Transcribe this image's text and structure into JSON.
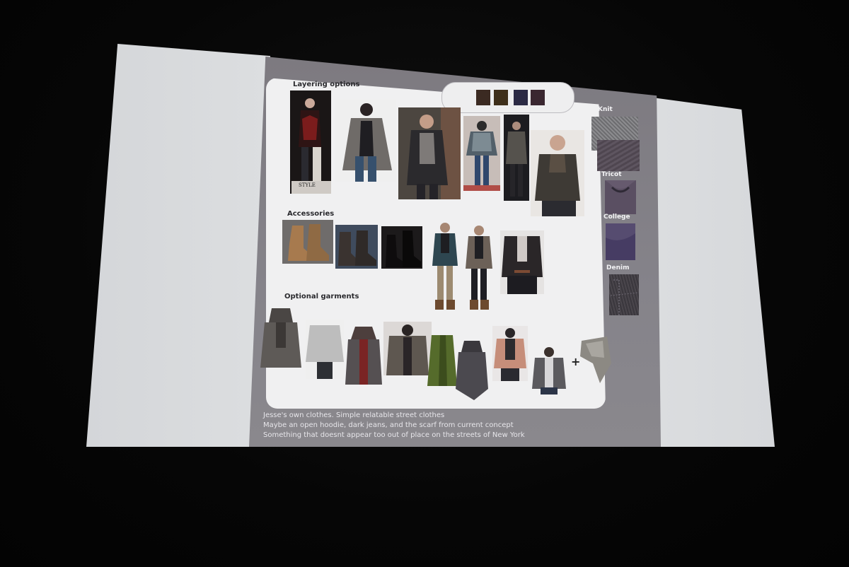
{
  "slide": {
    "sections": {
      "layering": "Layering options",
      "accessories": "Accessories",
      "optional": "Optional garments"
    },
    "fabrics": {
      "knit": "Knit",
      "tricot": "Tricot",
      "college": "College",
      "denim": "Denim"
    },
    "photo_text": {
      "style_tag": "STYLE"
    },
    "plus_sign": "+",
    "caption": {
      "line1": "Jesse's own clothes. Simple relatable street clothes",
      "line2": "Maybe an open hoodie, dark jeans, and the scarf from current concept",
      "line3": "Something that doesnt appear too out of place on the streets of New York"
    }
  },
  "colors": {
    "slide_bg": "#85838a",
    "panel_bg": "#f0f0f1",
    "swatches": [
      "#3b2a22",
      "#3e2f1a",
      "#2b2a44",
      "#3a2730"
    ],
    "knit": "#7b7b7e",
    "tricot": "#665a6e",
    "college": "#564c70",
    "college_inner": "#463c63",
    "denim": "#4a464c"
  },
  "icons": {
    "plus": "plus-icon"
  }
}
